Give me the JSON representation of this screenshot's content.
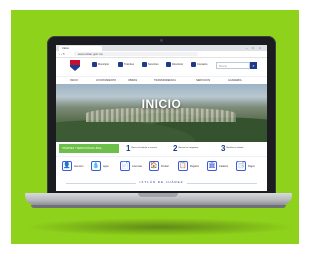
{
  "browser": {
    "tab_title": "Inicio",
    "url": "www.ixtlan.gob.mx",
    "window_controls": [
      "–",
      "□",
      "×"
    ],
    "nav_arrows": "‹ › ↻"
  },
  "header": {
    "links": [
      "Municipio",
      "Trámites",
      "Servicios",
      "Directorio",
      "Contacto"
    ],
    "search_placeholder": "Buscar",
    "search_button": "⌕"
  },
  "nav": {
    "items": [
      "INICIO",
      "AYUNTAMIENTO",
      "OBRAS",
      "TRANSPARENCIA",
      "SERVICIOS",
      "ACADEMIA"
    ]
  },
  "hero": {
    "title": "INICIO"
  },
  "steps": {
    "banner": "TRÁMITES Y SERVICIOS EN LÍNEA",
    "items": [
      {
        "num": "1",
        "text": "Busca el trámite o servicio"
      },
      {
        "num": "2",
        "text": "Revisa los requisitos"
      },
      {
        "num": "3",
        "text": "Realiza tu trámite"
      }
    ]
  },
  "quick": {
    "items": [
      {
        "icon": "👤",
        "label": "Atención"
      },
      {
        "icon": "💧",
        "label": "Agua"
      },
      {
        "icon": "📄",
        "label": "Licencias"
      },
      {
        "icon": "🏠",
        "label": "Predial"
      },
      {
        "icon": "📋",
        "label": "Registro"
      },
      {
        "icon": "🏛",
        "label": "Catastro"
      },
      {
        "icon": "📑",
        "label": "Pagos"
      }
    ]
  },
  "footer": {
    "slogan": "IXTLÁN DE JUÁREZ"
  },
  "colors": {
    "background_green": "#8fd21b",
    "brand_blue": "#1e3a8a",
    "accent_green": "#6cc04a"
  }
}
